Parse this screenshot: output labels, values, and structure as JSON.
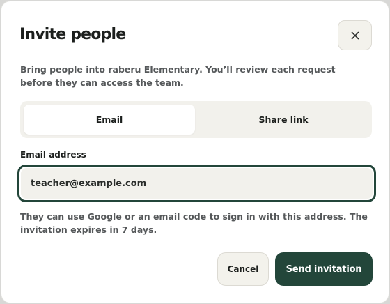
{
  "dialog": {
    "title": "Invite people",
    "close_icon": "close-icon",
    "description": "Bring people into raberu Elementary. You’ll review each request before they can access the team."
  },
  "tabs": {
    "items": [
      {
        "label": "Email",
        "selected": true
      },
      {
        "label": "Share link",
        "selected": false
      }
    ]
  },
  "email": {
    "label": "Email address",
    "value": "teacher@example.com",
    "helper": "They can use Google or an email code to sign in with this address. The invitation expires in 7 days."
  },
  "actions": {
    "cancel_label": "Cancel",
    "send_label": "Send invitation"
  },
  "colors": {
    "accent": "#23463a",
    "surface": "#f2f1ec",
    "text": "#1c1f1d",
    "muted_text": "#55585a"
  }
}
